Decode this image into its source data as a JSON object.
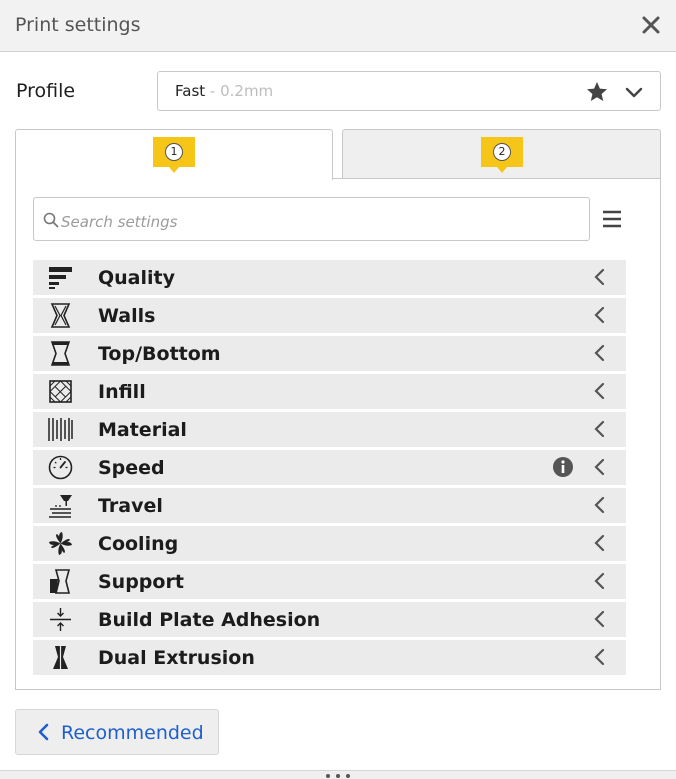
{
  "header": {
    "title": "Print settings",
    "close_icon": "close-icon"
  },
  "profile": {
    "label": "Profile",
    "name": "Fast",
    "description": " - 0.2mm",
    "favorite_icon": "star-icon",
    "dropdown_icon": "chevron-down-icon"
  },
  "tabs": [
    {
      "badge": "1",
      "accent": "#f5c518"
    },
    {
      "badge": "2",
      "accent": "#f5c518"
    }
  ],
  "search": {
    "placeholder": "Search settings"
  },
  "categories": [
    {
      "label": "Quality",
      "icon": "quality-icon"
    },
    {
      "label": "Walls",
      "icon": "walls-icon"
    },
    {
      "label": "Top/Bottom",
      "icon": "top-bottom-icon"
    },
    {
      "label": "Infill",
      "icon": "infill-icon"
    },
    {
      "label": "Material",
      "icon": "material-icon"
    },
    {
      "label": "Speed",
      "icon": "speed-icon",
      "info": true
    },
    {
      "label": "Travel",
      "icon": "travel-icon"
    },
    {
      "label": "Cooling",
      "icon": "cooling-icon"
    },
    {
      "label": "Support",
      "icon": "support-icon"
    },
    {
      "label": "Build Plate Adhesion",
      "icon": "build-plate-adhesion-icon"
    },
    {
      "label": "Dual Extrusion",
      "icon": "dual-extrusion-icon"
    }
  ],
  "footer": {
    "recommended_label": "Recommended"
  },
  "colors": {
    "accent": "#f5c518",
    "link": "#1f5fcc",
    "row_bg": "#ebebeb"
  }
}
